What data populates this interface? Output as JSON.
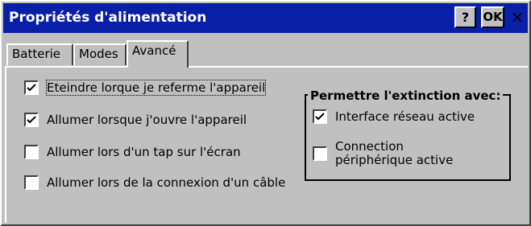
{
  "window": {
    "title": "Propriétés d'alimentation",
    "help_label": "?",
    "ok_label": "OK",
    "close_label": "×"
  },
  "tabs": [
    {
      "label": "Batterie",
      "selected": false
    },
    {
      "label": "Modes",
      "selected": false
    },
    {
      "label": "Avancé",
      "selected": true
    }
  ],
  "options": [
    {
      "label": "Eteindre lorque je referme l'appareil",
      "checked": true
    },
    {
      "label": "Allumer lorsque j'ouvre l'appareil",
      "checked": true
    },
    {
      "label": "Allumer lors d'un tap sur l'écran",
      "checked": false
    },
    {
      "label": "Allumer lors de la connexion d'un câble",
      "checked": false
    }
  ],
  "group": {
    "title": "Permettre l'extinction avec:",
    "items": [
      {
        "label": "Interface réseau active",
        "checked": true
      },
      {
        "label": "Connection périphérique active",
        "checked": false
      }
    ]
  }
}
